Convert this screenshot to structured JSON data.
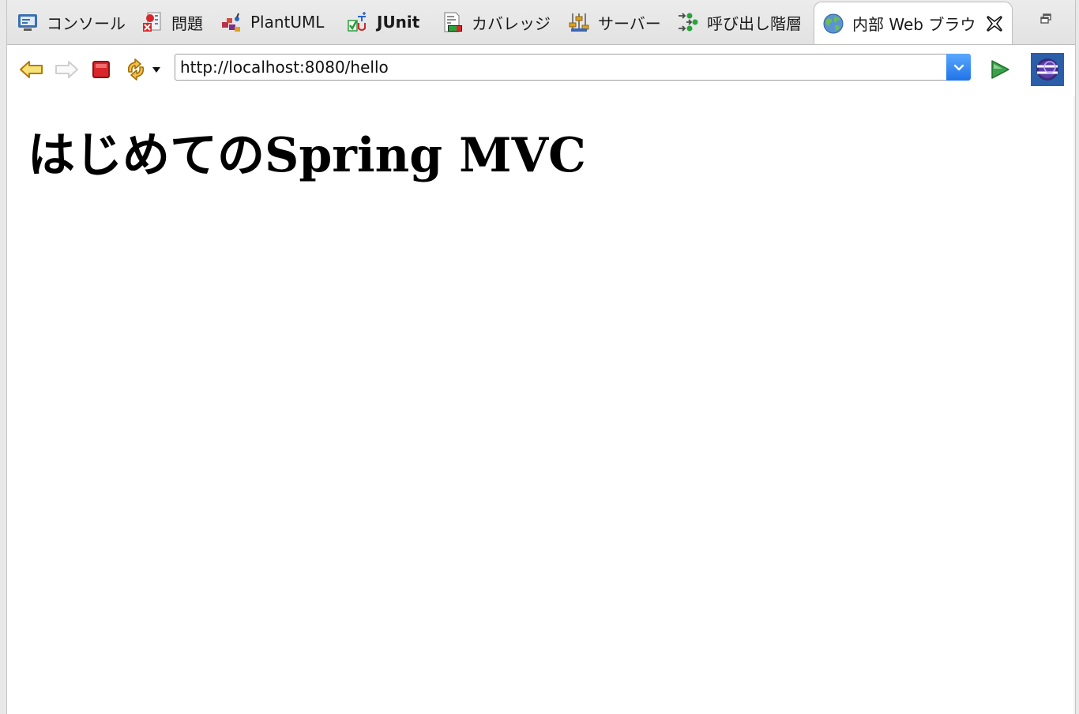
{
  "tabs": [
    {
      "label": "コンソール",
      "icon": "console-icon"
    },
    {
      "label": "問題",
      "icon": "problems-icon"
    },
    {
      "label": "PlantUML",
      "icon": "plantuml-icon"
    },
    {
      "label": "JUnit",
      "icon": "junit-icon"
    },
    {
      "label": "カバレッジ",
      "icon": "coverage-icon"
    },
    {
      "label": "サーバー",
      "icon": "servers-icon"
    },
    {
      "label": "呼び出し階層",
      "icon": "call-hierarchy-icon"
    },
    {
      "label": "内部 Web ブラウ",
      "icon": "globe-icon",
      "active": true
    }
  ],
  "toolbar": {
    "url": "http://localhost:8080/hello",
    "buttons": [
      "back-arrow-icon",
      "forward-arrow-icon",
      "stop-icon",
      "refresh-icon",
      "dropdown-caret-icon",
      "go-icon",
      "eclipse-icon"
    ]
  },
  "page": {
    "heading": "はじめてのSpring MVC"
  },
  "colors": {
    "active_tab_bg": "#ffffff",
    "tabbar_bg": "#e6e6e6",
    "url_dropdown": "#2f80ed",
    "go_arrow": "#3aa14a",
    "stop_red": "#d9262b"
  }
}
